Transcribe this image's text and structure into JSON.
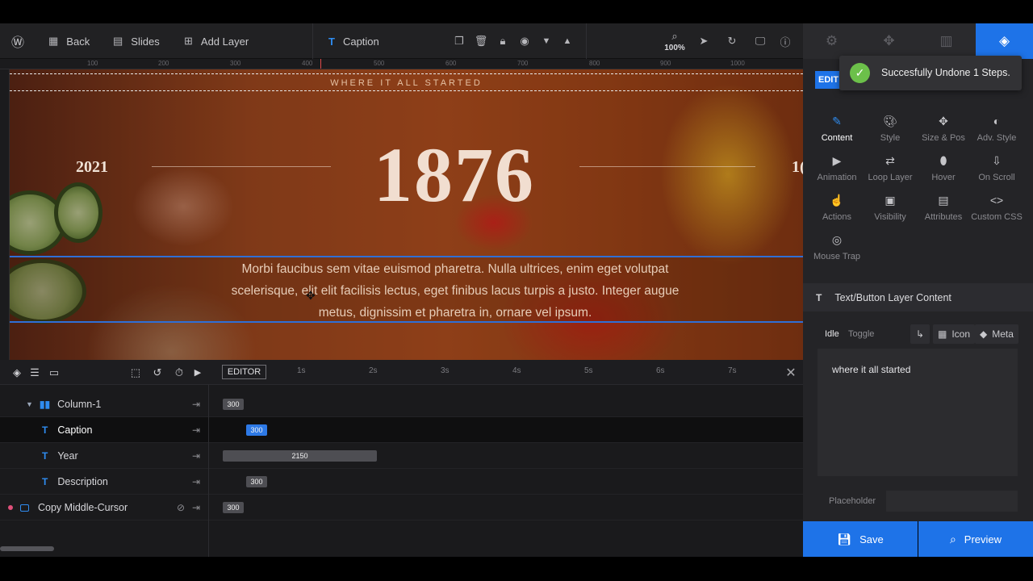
{
  "toolbar": {
    "back_label": "Back",
    "slides_label": "Slides",
    "add_layer_label": "Add Layer",
    "layer_name": "Caption",
    "zoom": "100%",
    "icons": {
      "wp": "wordpress-icon",
      "back": "grid-icon",
      "slides": "slides-icon",
      "add": "add-layer-icon",
      "text": "text-layer-icon",
      "duplicate": "duplicate-icon",
      "delete": "trash-icon",
      "lock": "lock-icon",
      "visibility": "eye-icon",
      "down": "arrow-down-icon",
      "up": "arrow-up-icon",
      "zoom": "zoom-icon",
      "cursor": "cursor-icon",
      "undo": "undo-icon",
      "device": "desktop-icon",
      "help": "help-icon"
    }
  },
  "right_tabs": [
    "settings-tab",
    "navigation-tab",
    "slides-tab",
    "layers-tab"
  ],
  "ruler": {
    "top_numbers": [
      "100",
      "200",
      "300",
      "400",
      "500",
      "600",
      "700",
      "800",
      "900",
      "1000"
    ]
  },
  "canvas": {
    "caption": "WHERE IT ALL STARTED",
    "year_left": "2021",
    "year_main": "1876",
    "year_right": "1(",
    "description": "Morbi faucibus sem vitae euismod pharetra. Nulla ultrices, enim eget volutpat scelerisque, elit elit facilisis lectus, eget finibus lacus turpis a justo. Integer augue metus, dignissim et pharetra in, ornare vel ipsum."
  },
  "timeline": {
    "editor_label": "EDITOR",
    "seconds": [
      "1s",
      "2s",
      "3s",
      "4s",
      "5s",
      "6s",
      "7s"
    ],
    "rows": [
      {
        "name": "Column-1",
        "bar": "300"
      },
      {
        "name": "Caption",
        "bar": "300"
      },
      {
        "name": "Year",
        "bar": "2150"
      },
      {
        "name": "Description",
        "bar": "300"
      },
      {
        "name": "Copy Middle-Cursor",
        "bar": "300"
      }
    ]
  },
  "panel": {
    "edit_label": "EDIT",
    "toast": "Succesfully Undone 1 Steps.",
    "options": [
      {
        "label": "Content",
        "icon": "pencil-icon"
      },
      {
        "label": "Style",
        "icon": "palette-icon"
      },
      {
        "label": "Size & Pos",
        "icon": "move-icon"
      },
      {
        "label": "Adv. Style",
        "icon": "contrast-icon"
      },
      {
        "label": "Animation",
        "icon": "play-icon"
      },
      {
        "label": "Loop Layer",
        "icon": "loop-icon"
      },
      {
        "label": "Hover",
        "icon": "mouse-icon"
      },
      {
        "label": "On Scroll",
        "icon": "scroll-icon"
      },
      {
        "label": "Actions",
        "icon": "actions-icon"
      },
      {
        "label": "Visibility",
        "icon": "visibility-icon"
      },
      {
        "label": "Attributes",
        "icon": "document-icon"
      },
      {
        "label": "Custom CSS",
        "icon": "code-icon"
      },
      {
        "label": "Mouse Trap",
        "icon": "target-icon"
      }
    ],
    "section_title": "Text/Button Layer Content",
    "subtabs": {
      "idle": "Idle",
      "toggle": "Toggle",
      "icon": "Icon",
      "meta": "Meta"
    },
    "content_text": "where it all started",
    "placeholder_label": "Placeholder",
    "save_label": "Save",
    "preview_label": "Preview"
  },
  "colors": {
    "accent": "#1e73e8",
    "success": "#6cc04a",
    "text_layer_icon": "#2f8cf0"
  }
}
